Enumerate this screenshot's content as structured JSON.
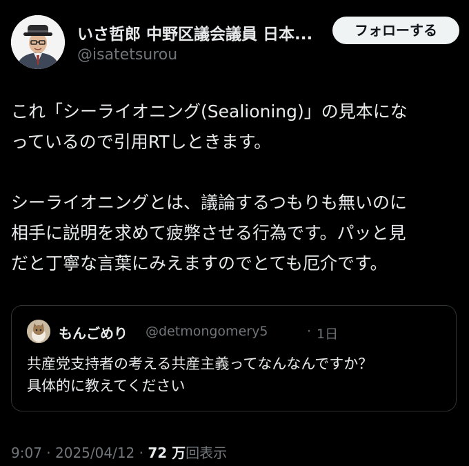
{
  "author": {
    "display_name": "いさ哲郎 中野区議会議員 日本...",
    "handle": "@isatetsurou"
  },
  "follow_button": {
    "label": "フォローする"
  },
  "post": {
    "paragraph1": "これ「シーライオニング(Sealioning)」の見本にな\nっているので引用RTしときます。",
    "paragraph2": "シーライオニングとは、議論するつもりも無いのに\n相手に説明を求めて疲弊させる行為です。パッと見\nだと丁寧な言葉にみえますのでとても厄介です。"
  },
  "quoted_post": {
    "display_name": "もんごめり",
    "handle": "@detmongomery5",
    "separator": "·",
    "time": "1日",
    "line1": "共産党支持者の考える共産主義ってなんなんですか？",
    "line2": "具体的に教えてください"
  },
  "meta": {
    "time": "9:07",
    "sep1": " · ",
    "date": "2025/04/12",
    "sep2": " · ",
    "views_count": "72 万",
    "views_label": "回表示"
  },
  "colors": {
    "background": "#000000",
    "primary_text": "#e7e9ea",
    "secondary_text": "#71767b",
    "border": "#2f3336",
    "follow_button_bg": "#eff3f4"
  }
}
